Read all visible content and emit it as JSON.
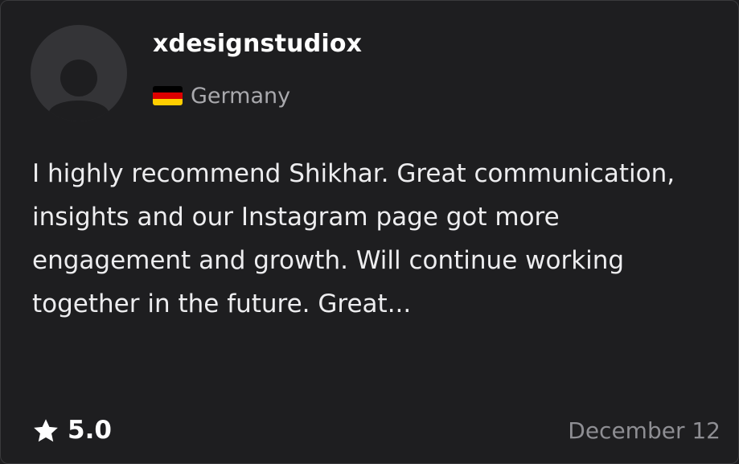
{
  "reviewer": {
    "username": "xdesignstudiox",
    "country": "Germany",
    "flag_colors": [
      "#000000",
      "#dd0000",
      "#ffce00"
    ]
  },
  "review": {
    "text": "I highly recommend Shikhar. Great communication, insights and our Instagram page got more engagement and growth. Will continue working together in the future. Great..."
  },
  "rating": {
    "icon": "star-icon",
    "value": "5.0"
  },
  "date": "December 12",
  "colors": {
    "background": "#1e1e20",
    "border": "#3a3a3c",
    "avatar_bg": "#343437",
    "avatar_fg": "#1e1e20",
    "muted_text": "#a9a9ad"
  }
}
